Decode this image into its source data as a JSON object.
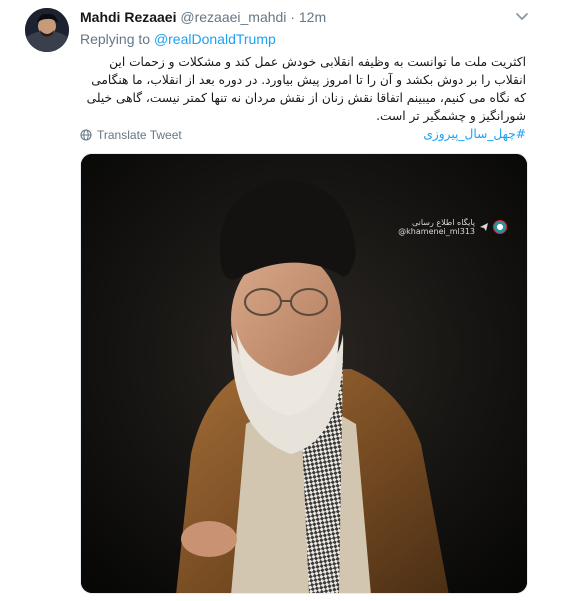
{
  "tweet": {
    "display_name": "Mahdi Rezaaei",
    "handle": "@rezaaei_mahdi",
    "separator": "·",
    "time": "12m",
    "replying_prefix": "Replying to",
    "replying_to": "@realDonaldTrump",
    "text": "اکثریت ملت ما توانست به وظیفه انقلابی خودش عمل کند و مشکلات و زحمات این انقلاب را بر دوش بکشد و آن را تا امروز پیش بیاورد. در دوره بعد از انقلاب، ما هنگامی که نگاه می کنیم، میبینم اتفاقا نقش زنان از نقش مردان نه تنها کمتر نیست، گاهی خیلی شورانگیز و چشمگیر تر است.",
    "hashtag": "#چهل_سال_پیروزی",
    "translate_label": "Translate Tweet"
  },
  "media": {
    "watermark_line1": "پایگاه اطلاع رسانی",
    "watermark_line2": "@khamenei_ml313"
  },
  "icons": {
    "avatar": "avatar",
    "caret": "chevron-down-icon",
    "translate": "globe-icon",
    "watermark": "telegram-icon"
  },
  "colors": {
    "link": "#1da1f2",
    "secondary_text": "#657786",
    "robe": "#7a4e24",
    "turban": "#141210"
  }
}
